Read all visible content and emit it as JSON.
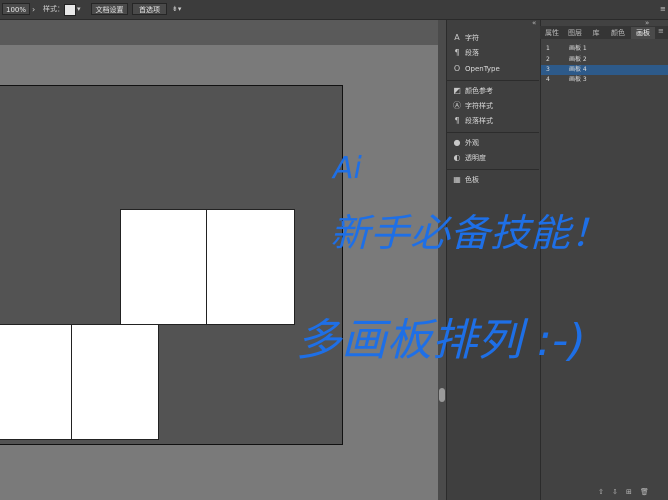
{
  "control_bar": {
    "zoom": "100%",
    "style_label": "样式：",
    "doc_setup": "文档设置",
    "preferences": "首选项"
  },
  "middle_panel": {
    "items": [
      {
        "label": "字符",
        "icon": "character-icon"
      },
      {
        "label": "段落",
        "icon": "paragraph-icon"
      },
      {
        "label": "OpenType",
        "icon": "opentype-icon"
      },
      {
        "label": "颜色参考",
        "icon": "color-guide-icon"
      },
      {
        "label": "字符样式",
        "icon": "character-styles-icon"
      },
      {
        "label": "段落样式",
        "icon": "paragraph-styles-icon"
      },
      {
        "label": "外观",
        "icon": "appearance-icon"
      },
      {
        "label": "透明度",
        "icon": "transparency-icon"
      },
      {
        "label": "色板",
        "icon": "swatches-icon"
      }
    ]
  },
  "right_panel": {
    "tabs": [
      "属性",
      "图层",
      "库",
      "颜色",
      "画板"
    ],
    "active_tab": "画板",
    "artboards": [
      {
        "num": "1",
        "name": "画板 1"
      },
      {
        "num": "2",
        "name": "画板 2"
      },
      {
        "num": "3",
        "name": "画板 4"
      },
      {
        "num": "4",
        "name": "画板 3"
      }
    ]
  },
  "handwriting": {
    "line1": "Ai",
    "line2": "新手必备技能！",
    "line3": "多画板排列 :-)",
    "color": "#1e6fe6"
  }
}
